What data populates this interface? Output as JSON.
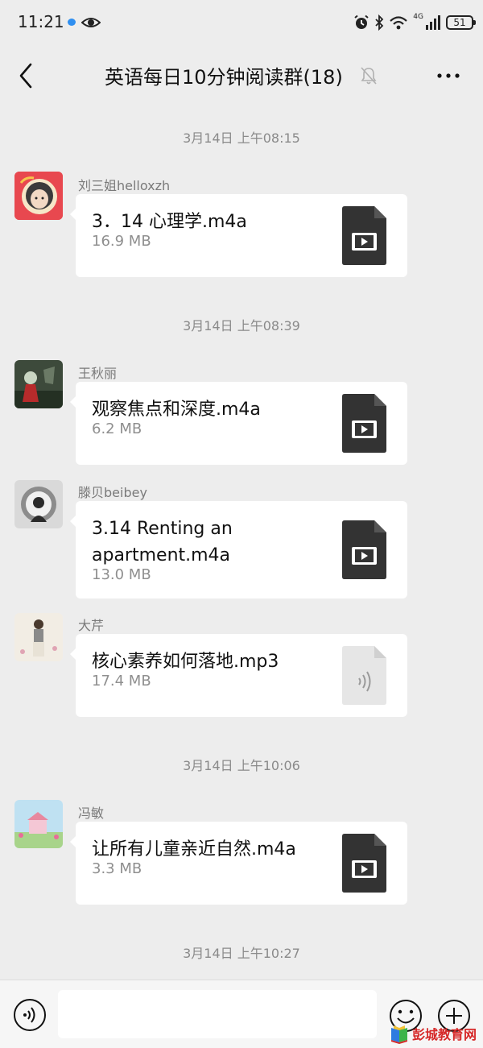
{
  "status_bar": {
    "time": "11:21",
    "network": "4G",
    "battery": "51"
  },
  "header": {
    "title": "英语每日10分钟阅读群(18)",
    "back_icon": "chevron-left-icon",
    "mute_icon": "bell-off-icon",
    "more_icon": "more-horizontal-icon"
  },
  "messages": [
    {
      "time": "3月14日 上午08:15"
    },
    {
      "sender": "刘三姐helloxzh",
      "file_name": "3．14 心理学.m4a",
      "file_size": "16.9 MB",
      "file_type": "video-file-icon"
    },
    {
      "time": "3月14日 上午08:39"
    },
    {
      "sender": "王秋丽",
      "file_name": "观察焦点和深度.m4a",
      "file_size": "6.2 MB",
      "file_type": "video-file-icon"
    },
    {
      "sender": "滕贝beibey",
      "file_name": "3.14 Renting an apartment.m4a",
      "file_size": "13.0 MB",
      "file_type": "video-file-icon"
    },
    {
      "sender": "大芹",
      "file_name": "核心素养如何落地.mp3",
      "file_size": "17.4 MB",
      "file_type": "audio-file-icon"
    },
    {
      "time": "3月14日 上午10:06"
    },
    {
      "sender": "冯敏",
      "file_name": "让所有儿童亲近自然.m4a",
      "file_size": "3.3 MB",
      "file_type": "video-file-icon"
    },
    {
      "time": "3月14日 上午10:27"
    }
  ],
  "input_bar": {
    "placeholder": "",
    "voice_icon": "voice-icon",
    "emoji_icon": "emoji-icon",
    "plus_icon": "plus-icon"
  },
  "watermark": "彭城教育网",
  "colors": {
    "background": "#ededed",
    "bubble": "#ffffff",
    "file_icon": "#333333",
    "audio_icon": "#e6e6e6",
    "watermark": "#d62828"
  }
}
